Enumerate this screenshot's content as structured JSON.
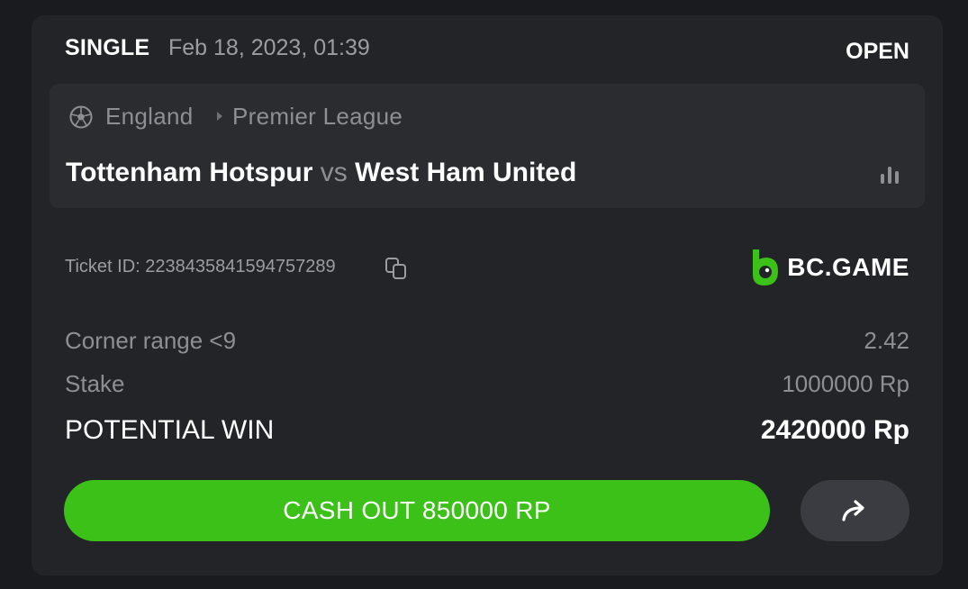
{
  "bet": {
    "type": "SINGLE",
    "date": "Feb 18, 2023, 01:39",
    "status": "OPEN"
  },
  "event": {
    "sport_icon": "soccer-ball-icon",
    "country": "England",
    "league": "Premier League",
    "home_team": "Tottenham Hotspur",
    "vs": "vs",
    "away_team": "West Ham United",
    "stats_icon": "bar-chart-icon"
  },
  "ticket": {
    "label": "Ticket ID: 2238435841594757289",
    "copy_icon": "copy-icon"
  },
  "brand": {
    "name": "BC.GAME",
    "color": "#3bc117"
  },
  "selection": {
    "market": "Corner range <9",
    "odds": "2.42"
  },
  "stake": {
    "label": "Stake",
    "value": "1000000 Rp"
  },
  "potential_win": {
    "label": "POTENTIAL WIN",
    "value": "2420000 Rp"
  },
  "actions": {
    "cashout_label": "CASH OUT 850000 RP",
    "cashout_color": "#3bc117",
    "share_icon": "share-arrow-icon"
  }
}
